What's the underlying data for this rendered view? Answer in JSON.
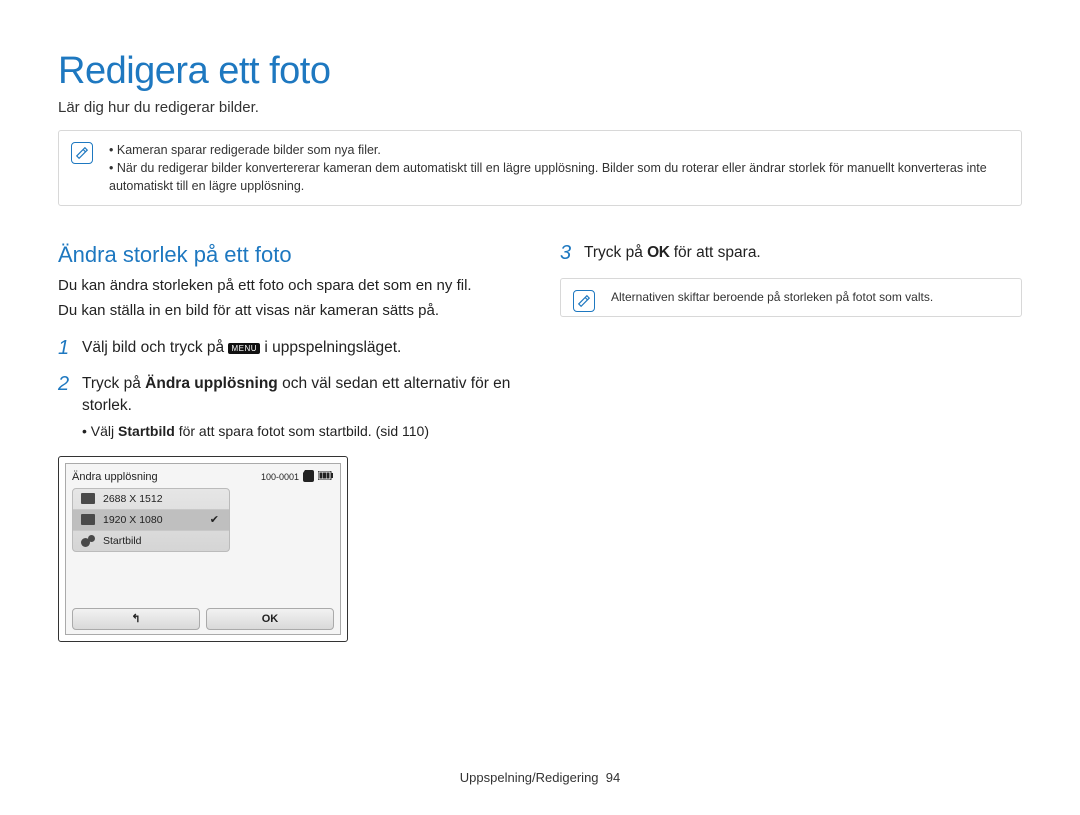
{
  "title": "Redigera ett foto",
  "subtitle": "Lär dig hur du redigerar bilder.",
  "top_note": {
    "bullets": [
      "Kameran sparar redigerade bilder som nya filer.",
      "När du redigerar bilder konvertererar kameran dem automatiskt till en lägre upplösning. Bilder som du roterar eller ändrar storlek för manuellt konverteras inte automatiskt till en lägre upplösning."
    ]
  },
  "left": {
    "section_title": "Ändra storlek på ett foto",
    "p1": "Du kan ändra storleken på ett foto och spara det som en ny fil.",
    "p2": "Du kan ställa in en bild för att visas när kameran sätts på.",
    "steps": {
      "s1_pre": "Välj bild och tryck på ",
      "s1_chip": "MENU",
      "s1_post": " i uppspelningsläget.",
      "s2_pre": "Tryck på ",
      "s2_bold": "Ändra upplösning",
      "s2_post": " och väl sedan ett alternativ för en storlek.",
      "s2_sub_pre": "Välj ",
      "s2_sub_bold": "Startbild",
      "s2_sub_post": " för att spara fotot som startbild. (sid 110)"
    }
  },
  "right": {
    "step3_pre": "Tryck på ",
    "step3_ok": "OK",
    "step3_post": " för att spara.",
    "note": "Alternativen skiftar beroende på storleken på fotot som valts."
  },
  "camera": {
    "header_title": "Ändra upplösning",
    "header_counter": "100-0001",
    "options": [
      {
        "label": "2688 X 1512",
        "selected": false,
        "icon": "res"
      },
      {
        "label": "1920 X 1080",
        "selected": true,
        "icon": "res"
      },
      {
        "label": "Startbild",
        "selected": false,
        "icon": "start"
      }
    ],
    "back_glyph": "↰",
    "ok_label": "OK"
  },
  "footer": {
    "section": "Uppspelning/Redigering",
    "page": "94"
  }
}
